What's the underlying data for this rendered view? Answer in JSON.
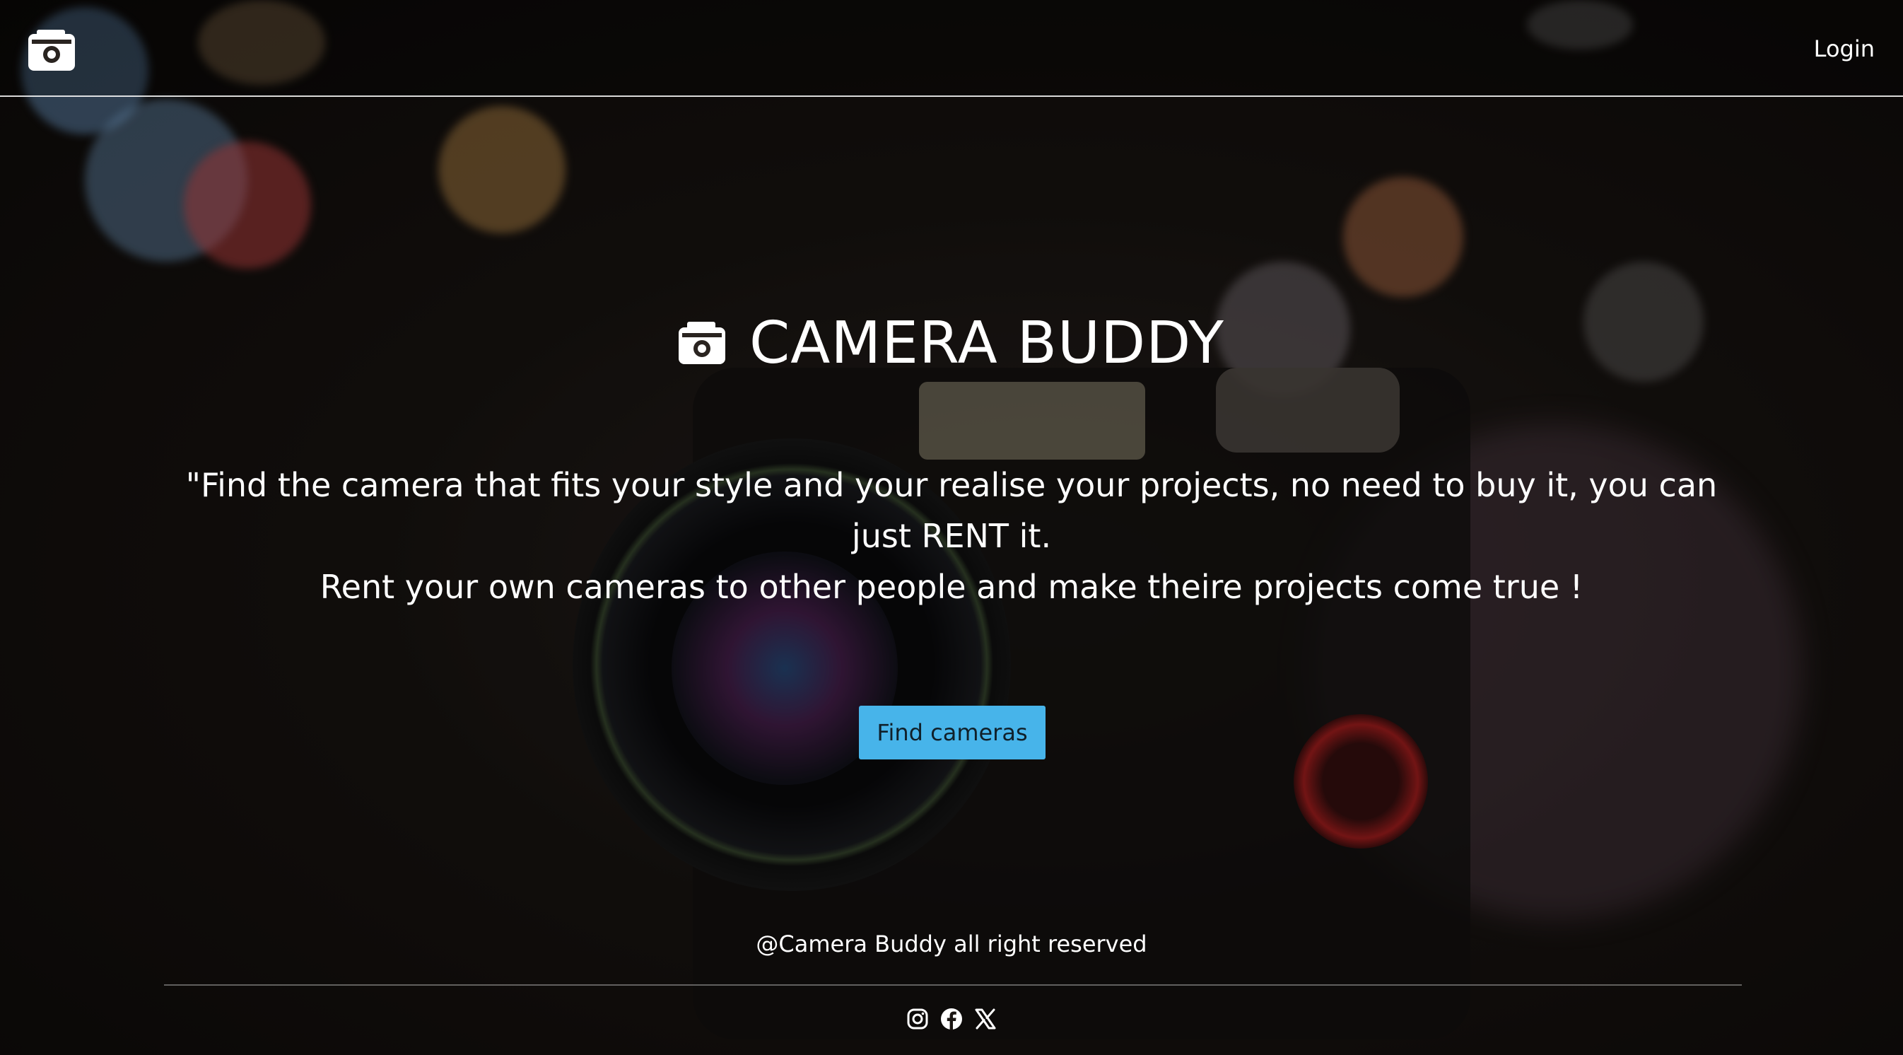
{
  "nav": {
    "logo_icon": "camera-icon",
    "login_label": "Login"
  },
  "hero": {
    "title_icon": "camera-icon",
    "title": "CAMERA BUDDY",
    "tagline_line1": "\"Find the camera that fits your style and your realise your projects, no need to buy it, you can just RENT it.",
    "tagline_line2": "Rent your own cameras to other people and make theire projects come true !",
    "cta_label": "Find cameras"
  },
  "footer": {
    "copyright": "@Camera Buddy all right reserved",
    "socials": [
      "instagram-icon",
      "facebook-icon",
      "x-icon"
    ]
  },
  "colors": {
    "accent": "#47b4ea",
    "text": "#ffffff"
  }
}
